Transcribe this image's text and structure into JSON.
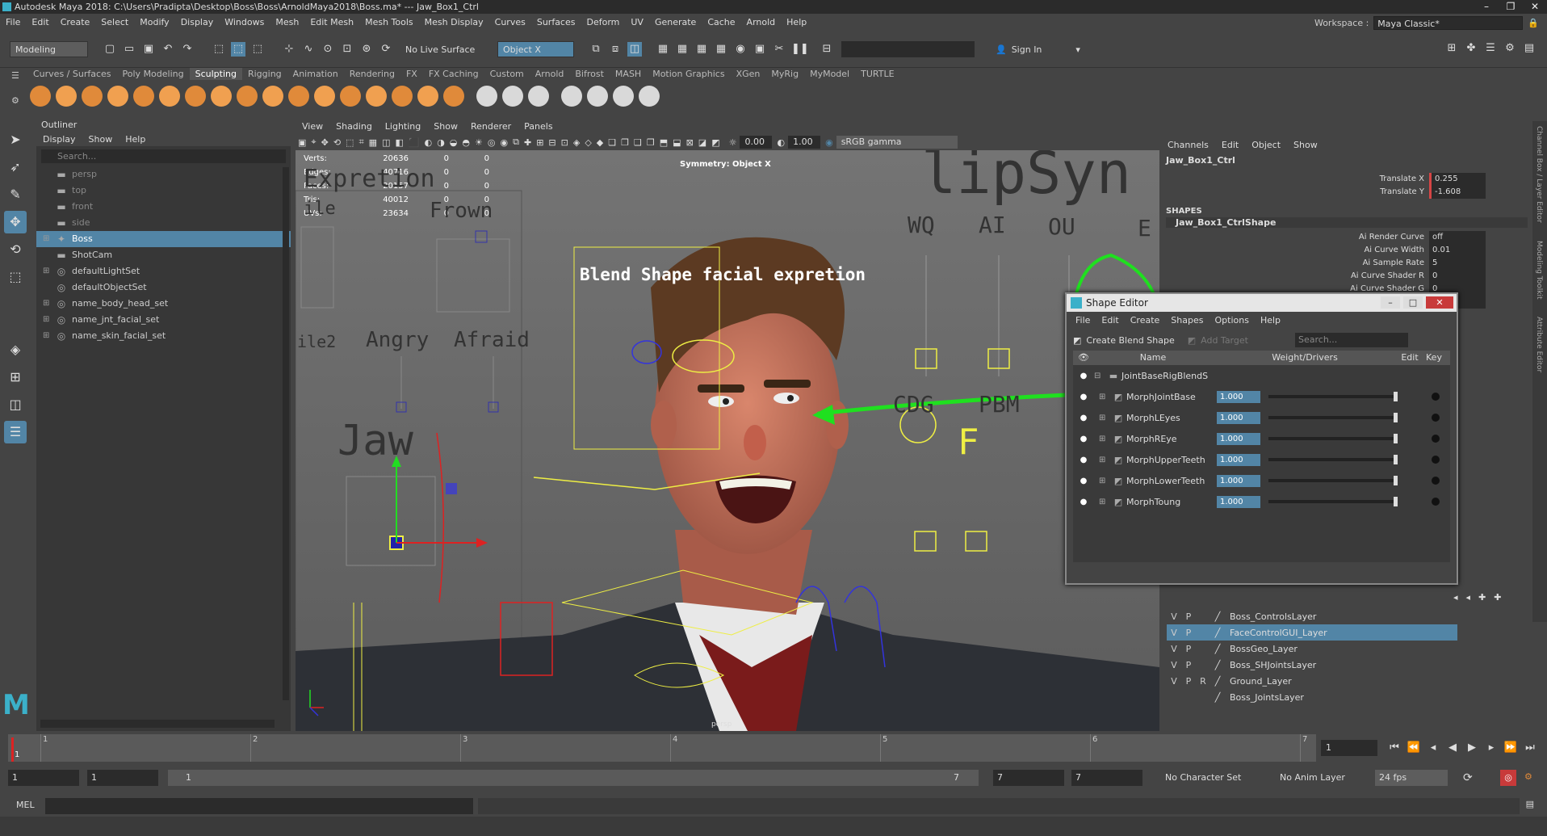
{
  "title_bar": {
    "text": "Autodesk Maya 2018: C:\\Users\\Pradipta\\Desktop\\Boss\\Boss\\ArnoldMaya2018\\Boss.ma*  ---  Jaw_Box1_Ctrl",
    "controls": [
      "–",
      "❐",
      "✕"
    ]
  },
  "menu": [
    "File",
    "Edit",
    "Create",
    "Select",
    "Modify",
    "Display",
    "Windows",
    "Mesh",
    "Edit Mesh",
    "Mesh Tools",
    "Mesh Display",
    "Curves",
    "Surfaces",
    "Deform",
    "UV",
    "Generate",
    "Cache",
    "Arnold",
    "Help"
  ],
  "workspace": {
    "label": "Workspace :",
    "value": "Maya Classic*"
  },
  "status_line": {
    "mode": "Modeling",
    "live_surface": "No Live Surface",
    "object_mode": "Object X",
    "sign_in": "Sign In"
  },
  "shelf_tabs": [
    "Curves / Surfaces",
    "Poly Modeling",
    "Sculpting",
    "Rigging",
    "Animation",
    "Rendering",
    "FX",
    "FX Caching",
    "Custom",
    "Arnold",
    "Bifrost",
    "MASH",
    "Motion Graphics",
    "XGen",
    "MyRig",
    "MyModel",
    "TURTLE"
  ],
  "shelf_active": "Sculpting",
  "outliner": {
    "title": "Outliner",
    "menu": [
      "Display",
      "Show",
      "Help"
    ],
    "search_placeholder": "Search...",
    "items": [
      {
        "label": "persp",
        "icon": "camera-icon",
        "dim": true,
        "expand": ""
      },
      {
        "label": "top",
        "icon": "camera-icon",
        "dim": true,
        "expand": ""
      },
      {
        "label": "front",
        "icon": "camera-icon",
        "dim": true,
        "expand": ""
      },
      {
        "label": "side",
        "icon": "camera-icon",
        "dim": true,
        "expand": ""
      },
      {
        "label": "Boss",
        "icon": "joint-icon",
        "selected": true,
        "expand": "⊞"
      },
      {
        "label": "ShotCam",
        "icon": "camera-icon",
        "expand": ""
      },
      {
        "label": "defaultLightSet",
        "icon": "set-icon",
        "expand": "⊞"
      },
      {
        "label": "defaultObjectSet",
        "icon": "set-icon",
        "expand": ""
      },
      {
        "label": "name_body_head_set",
        "icon": "set-icon",
        "expand": "⊞"
      },
      {
        "label": "name_jnt_facial_set",
        "icon": "set-icon",
        "expand": "⊞"
      },
      {
        "label": "name_skin_facial_set",
        "icon": "set-icon",
        "expand": "⊞"
      }
    ]
  },
  "viewport": {
    "menu": [
      "View",
      "Shading",
      "Lighting",
      "Show",
      "Renderer",
      "Panels"
    ],
    "field1": "0.00",
    "field2": "1.00",
    "color_space": "sRGB gamma",
    "hud": [
      {
        "k": "Verts:",
        "v": "20636",
        "a": "0",
        "b": "0"
      },
      {
        "k": "Edges:",
        "v": "40716",
        "a": "0",
        "b": "0"
      },
      {
        "k": "Faces:",
        "v": "20157",
        "a": "0",
        "b": "0"
      },
      {
        "k": "Tris:",
        "v": "40012",
        "a": "0",
        "b": "0"
      },
      {
        "k": "UVs:",
        "v": "23634",
        "a": "0",
        "b": "0"
      }
    ],
    "symmetry": "Symmetry: Object X",
    "camera": "persp",
    "labels": {
      "expretion": "Expretion",
      "frown": "Frown",
      "ile": "ile",
      "ile2": "ile2",
      "angry": "Angry",
      "afraid": "Afraid",
      "jaw": "Jaw",
      "lipsync": "lipSyn",
      "wq": "WQ",
      "ai": "AI",
      "ou": "OU",
      "e": "E",
      "cdg": "CDG",
      "pbm": "PBM",
      "f": "F",
      "blend_title": "Blend Shape facial expretion"
    }
  },
  "channel_box": {
    "menu": [
      "Channels",
      "Edit",
      "Object",
      "Show"
    ],
    "object": "Jaw_Box1_Ctrl",
    "attrs": [
      {
        "k": "Translate X",
        "v": "0.255"
      },
      {
        "k": "Translate Y",
        "v": "-1.608"
      }
    ],
    "shapes_label": "SHAPES",
    "shape_name": "Jaw_Box1_CtrlShape",
    "shape_attrs": [
      {
        "k": "Ai Render Curve",
        "v": "off"
      },
      {
        "k": "Ai Curve Width",
        "v": "0.01"
      },
      {
        "k": "Ai Sample Rate",
        "v": "5"
      },
      {
        "k": "Ai Curve Shader R",
        "v": "0"
      },
      {
        "k": "Ai Curve Shader G",
        "v": "0"
      },
      {
        "k": "Ai Curve Shader B",
        "v": "0"
      }
    ],
    "side_tabs": [
      "Channel Box / Layer Editor",
      "Modeling Toolkit",
      "Attribute Editor"
    ]
  },
  "layers": [
    {
      "v": "V",
      "p": "P",
      "r": "",
      "name": "Boss_ControlsLayer"
    },
    {
      "v": "V",
      "p": "P",
      "r": "",
      "name": "FaceControlGUI_Layer",
      "selected": true
    },
    {
      "v": "V",
      "p": "P",
      "r": "",
      "name": "BossGeo_Layer"
    },
    {
      "v": "V",
      "p": "P",
      "r": "",
      "name": "Boss_SHJointsLayer"
    },
    {
      "v": "V",
      "p": "P",
      "r": "R",
      "name": "Ground_Layer"
    },
    {
      "v": "",
      "p": "",
      "r": "",
      "name": "Boss_JointsLayer"
    }
  ],
  "shape_editor": {
    "title": "Shape Editor",
    "menu": [
      "File",
      "Edit",
      "Create",
      "Shapes",
      "Options",
      "Help"
    ],
    "create_btn": "Create Blend Shape",
    "add_target": "Add Target",
    "search_placeholder": "Search...",
    "columns": {
      "name": "Name",
      "weight": "Weight/Drivers",
      "edit": "Edit",
      "key": "Key"
    },
    "group": "JointBaseRigBlendS",
    "targets": [
      {
        "name": "MorphJointBase",
        "weight": "1.000",
        "fraction": 1.0
      },
      {
        "name": "MorphLEyes",
        "weight": "1.000",
        "fraction": 1.0
      },
      {
        "name": "MorphREye",
        "weight": "1.000",
        "fraction": 1.0
      },
      {
        "name": "MorphUpperTeeth",
        "weight": "1.000",
        "fraction": 1.0
      },
      {
        "name": "MorphLowerTeeth",
        "weight": "1.000",
        "fraction": 1.0
      },
      {
        "name": "MorphToung",
        "weight": "1.000",
        "fraction": 1.0
      }
    ]
  },
  "timeline": {
    "ticks": [
      "1",
      "2",
      "3",
      "4",
      "5",
      "6",
      "7"
    ],
    "current_frame_label": "1",
    "current_frame": "1"
  },
  "range": {
    "start": "1",
    "playback_start": "1",
    "slider_start": "1",
    "slider_end": "7",
    "playback_end": "7",
    "end": "7",
    "character_set": "No Character Set",
    "anim_layer": "No Anim Layer",
    "fps": "24 fps"
  },
  "cmd": {
    "label": "MEL"
  },
  "colors": {
    "accent": "#5285a6",
    "annotation_green": "#1fe01f",
    "ctrl_yellow": "#e6e64a"
  }
}
